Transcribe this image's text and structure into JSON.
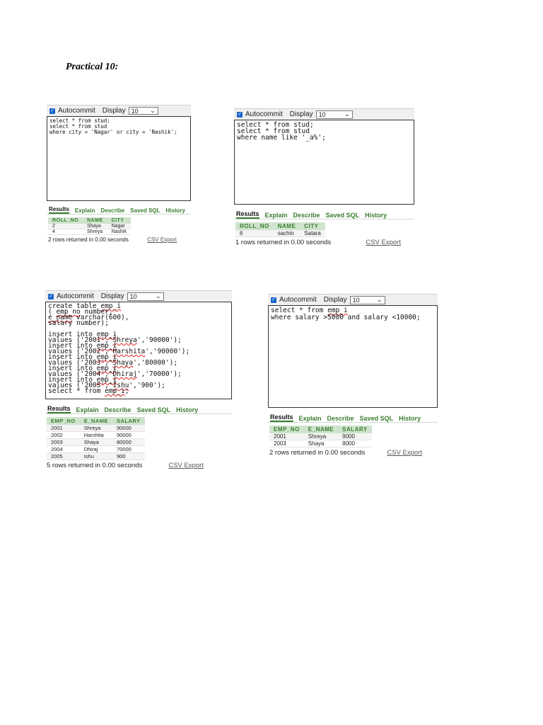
{
  "page_title": "Practical 10:",
  "panels": [
    {
      "autocommit_label": "Autocommit",
      "display_label": "Display",
      "display_value": "10",
      "sql_lines": [
        "select * from stud;",
        "select * from stud",
        "where city = 'Nagar' or city = 'Nashik';"
      ],
      "tabs": [
        "Results",
        "Explain",
        "Describe",
        "Saved SQL",
        "History"
      ],
      "columns": [
        "ROLL_NO",
        "NAME",
        "CITY"
      ],
      "rows": [
        [
          "2",
          "Shaya",
          "Nagar"
        ],
        [
          "4",
          "Shreya",
          "Nashik"
        ]
      ],
      "status": "2 rows returned in 0.00 seconds",
      "csv_export": "CSV Export"
    },
    {
      "autocommit_label": "Autocommit",
      "display_label": "Display",
      "display_value": "10",
      "sql_lines": [
        "select * from stud;",
        "select * from stud",
        "where name like '_a%';"
      ],
      "tabs": [
        "Results",
        "Explain",
        "Describe",
        "Saved SQL",
        "History"
      ],
      "columns": [
        "ROLL_NO",
        "NAME",
        "CITY"
      ],
      "rows": [
        [
          "6",
          "sachin",
          "Satara"
        ]
      ],
      "status": "1 rows returned in 0.00 seconds",
      "csv_export": "CSV Export"
    },
    {
      "autocommit_label": "Autocommit",
      "display_label": "Display",
      "display_value": "10",
      "sql_lines": [
        "create table emp_i",
        "( emp_no number,",
        "e_name varchar(600),",
        "salary number);",
        "",
        "insert into emp_i",
        "values ('2001','Shreya','90000');",
        "insert into emp_i",
        "values ('2002','Harshita','90000');",
        "insert into emp_i",
        "values ('2003','Shaya','80000');",
        "insert into emp_i",
        "values ('2004','Dhiraj','70000');",
        "insert into emp_i",
        "values ('2005','Ishu','900');",
        "select * from emp_i;"
      ],
      "tabs": [
        "Results",
        "Explain",
        "Describe",
        "Saved SQL",
        "History"
      ],
      "columns": [
        "EMP_NO",
        "E_NAME",
        "SALARY"
      ],
      "rows": [
        [
          "2001",
          "Shreya",
          "90000"
        ],
        [
          "2002",
          "Harshita",
          "90000"
        ],
        [
          "2003",
          "Shaya",
          "80000"
        ],
        [
          "2004",
          "Dhiraj",
          "70000"
        ],
        [
          "2005",
          "Ishu",
          "900"
        ]
      ],
      "status": "5 rows returned in 0.00 seconds",
      "csv_export": "CSV Export"
    },
    {
      "autocommit_label": "Autocommit",
      "display_label": "Display",
      "display_value": "10",
      "sql_lines": [
        "select * from emp_i",
        "where salary >5000 and salary <10000;"
      ],
      "tabs": [
        "Results",
        "Explain",
        "Describe",
        "Saved SQL",
        "History"
      ],
      "columns": [
        "EMP_NO",
        "E_NAME",
        "SALARY"
      ],
      "rows": [
        [
          "2001",
          "Shreya",
          "9000"
        ],
        [
          "2003",
          "Shaya",
          "8000"
        ]
      ],
      "status": "2 rows returned in 0.00 seconds",
      "csv_export": "CSV Export"
    }
  ]
}
